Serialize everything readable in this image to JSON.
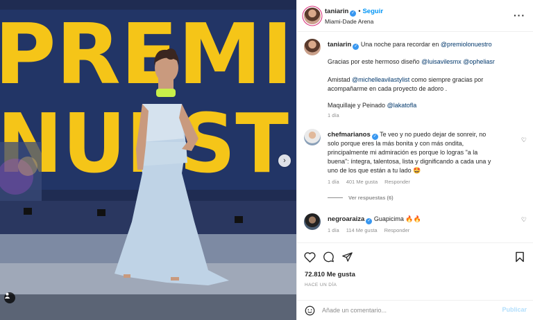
{
  "post": {
    "author": "taniarin",
    "follow_label": "Seguir",
    "location": "Miami-Dade Arena",
    "more_icon": "more-options-icon"
  },
  "caption": {
    "author": "taniarin",
    "line1_text": "Una noche para recordar en",
    "line1_mention": "@premiolonuestro",
    "line2_text": "Gracias por este hermoso diseño",
    "line2_mention1": "@luisavilesmx",
    "line2_mention2": "@opheliasr",
    "line3_prefix": "Amistad",
    "line3_mention": "@michelleavilastylist",
    "line3_text": "como siempre gracias por",
    "line4_text": "acompañarme en cada proyecto de adoro .",
    "line5_text": "Maquillaje y Peinado",
    "line5_mention": "@lakatofla",
    "time": "1 día"
  },
  "comments": [
    {
      "user": "chefmarianos",
      "lines": [
        "Te veo y no puedo dejar de sonreir, no",
        "solo porque eres la más bonita y con más ondita,",
        "principalmente mi admiración es porque lo logras \"a la",
        "buena\": íntegra, talentosa, lista y dignificando a cada una y",
        "uno de los que están a tu lado 🤩"
      ],
      "time": "1 día",
      "likes": "401 Me gusta",
      "reply_label": "Responder"
    },
    {
      "user": "negroaraiza",
      "text": "Guapicima 🔥🔥",
      "time": "1 día",
      "likes": "114 Me gusta",
      "reply_label": "Responder"
    }
  ],
  "view_replies_label": "Ver respuestas (6)",
  "engagement": {
    "likes_count": "72.810 Me gusta",
    "posted_ago": "HACE UN DÍA"
  },
  "comment_box": {
    "placeholder": "Añade un comentario...",
    "post_label": "Publicar"
  },
  "photo": {
    "sign_text": "PREMI NUEST"
  },
  "colors": {
    "link": "#00376b",
    "accent": "#0095f6",
    "verified": "#3897f0",
    "publish_disabled": "#b2dffc",
    "sign_yellow": "#f5c518"
  }
}
